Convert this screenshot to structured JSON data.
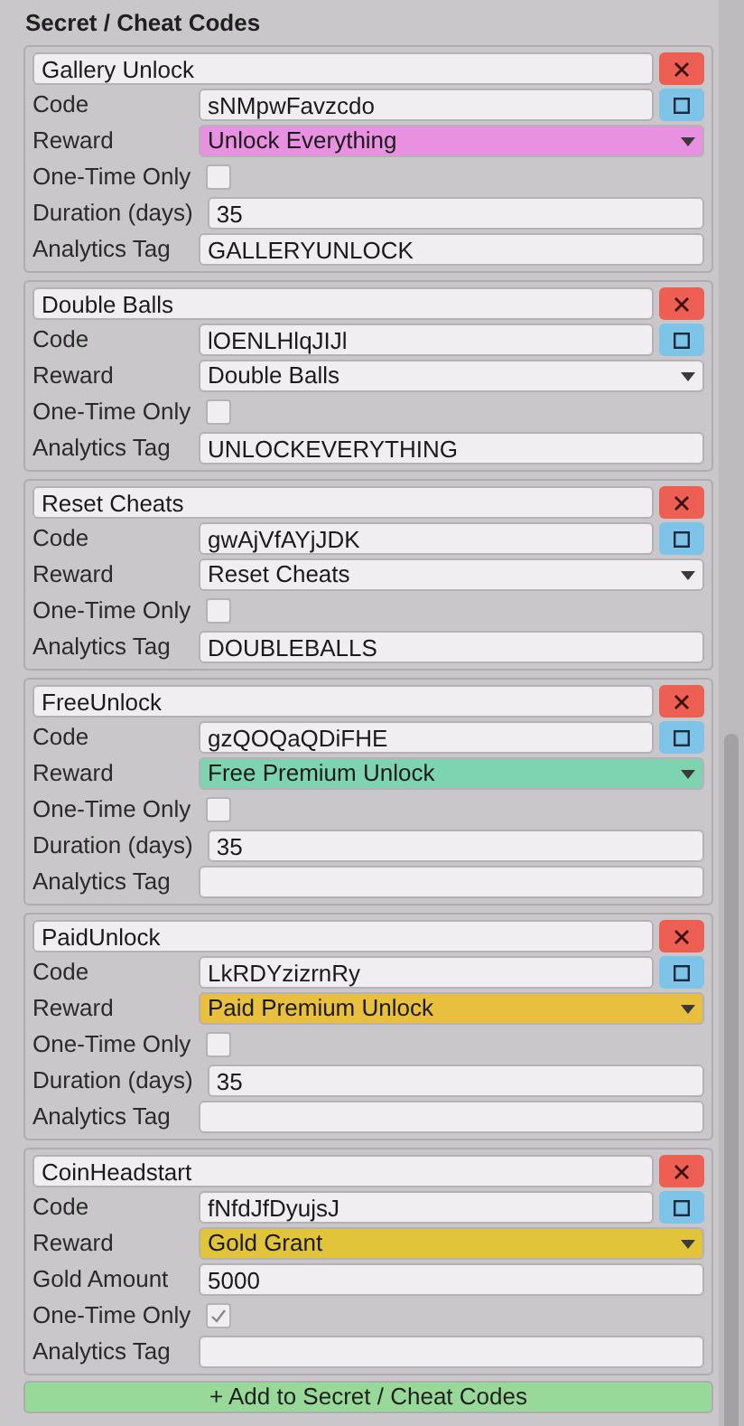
{
  "section": {
    "title": "Secret / Cheat Codes"
  },
  "codes": [
    {
      "name": "Gallery Unlock",
      "code_label": "Code",
      "code": "sNMpwFavzcdo",
      "reward_label": "Reward",
      "reward": "Unlock Everything",
      "color": "#e891e0",
      "fields": [
        {
          "kind": "checkbox",
          "label": "One-Time Only",
          "checked": false
        },
        {
          "kind": "text",
          "label": "Duration (days)",
          "value": "35"
        },
        {
          "kind": "text",
          "label": "Analytics Tag",
          "value": "GALLERYUNLOCK"
        }
      ]
    },
    {
      "name": "Double Balls",
      "code_label": "Code",
      "code": "lOENLHlqJIJl",
      "reward_label": "Reward",
      "reward": "Double Balls",
      "color": "#f0eef0",
      "fields": [
        {
          "kind": "checkbox",
          "label": "One-Time Only",
          "checked": false
        },
        {
          "kind": "text",
          "label": "Analytics Tag",
          "value": "UNLOCKEVERYTHING"
        }
      ]
    },
    {
      "name": "Reset Cheats",
      "code_label": "Code",
      "code": "gwAjVfAYjJDK",
      "reward_label": "Reward",
      "reward": "Reset Cheats",
      "color": "#f0eef0",
      "fields": [
        {
          "kind": "checkbox",
          "label": "One-Time Only",
          "checked": false
        },
        {
          "kind": "text",
          "label": "Analytics Tag",
          "value": "DOUBLEBALLS"
        }
      ]
    },
    {
      "name": "FreeUnlock",
      "code_label": "Code",
      "code": "gzQOQaQDiFHE",
      "reward_label": "Reward",
      "reward": "Free Premium Unlock",
      "color": "#7ed4b0",
      "fields": [
        {
          "kind": "checkbox",
          "label": "One-Time Only",
          "checked": false
        },
        {
          "kind": "text",
          "label": "Duration (days)",
          "value": "35"
        },
        {
          "kind": "text",
          "label": "Analytics Tag"
        }
      ]
    },
    {
      "name": "PaidUnlock",
      "code_label": "Code",
      "code": "LkRDYzizrnRy",
      "reward_label": "Reward",
      "reward": "Paid Premium Unlock",
      "color": "#e8bf3e",
      "fields": [
        {
          "kind": "checkbox",
          "label": "One-Time Only",
          "checked": false
        },
        {
          "kind": "text",
          "label": "Duration (days)",
          "value": "35"
        },
        {
          "kind": "text",
          "label": "Analytics Tag"
        }
      ]
    },
    {
      "name": "CoinHeadstart",
      "code_label": "Code",
      "code": "fNfdJfDyujsJ",
      "reward_label": "Reward",
      "reward": "Gold Grant",
      "color": "#e2c43a",
      "fields": [
        {
          "kind": "text",
          "label": "Gold Amount",
          "value": "5000"
        },
        {
          "kind": "checkbox",
          "label": "One-Time Only",
          "checked": true
        },
        {
          "kind": "text",
          "label": "Analytics Tag"
        }
      ]
    }
  ],
  "add_button": "+ Add to Secret / Cheat Codes"
}
